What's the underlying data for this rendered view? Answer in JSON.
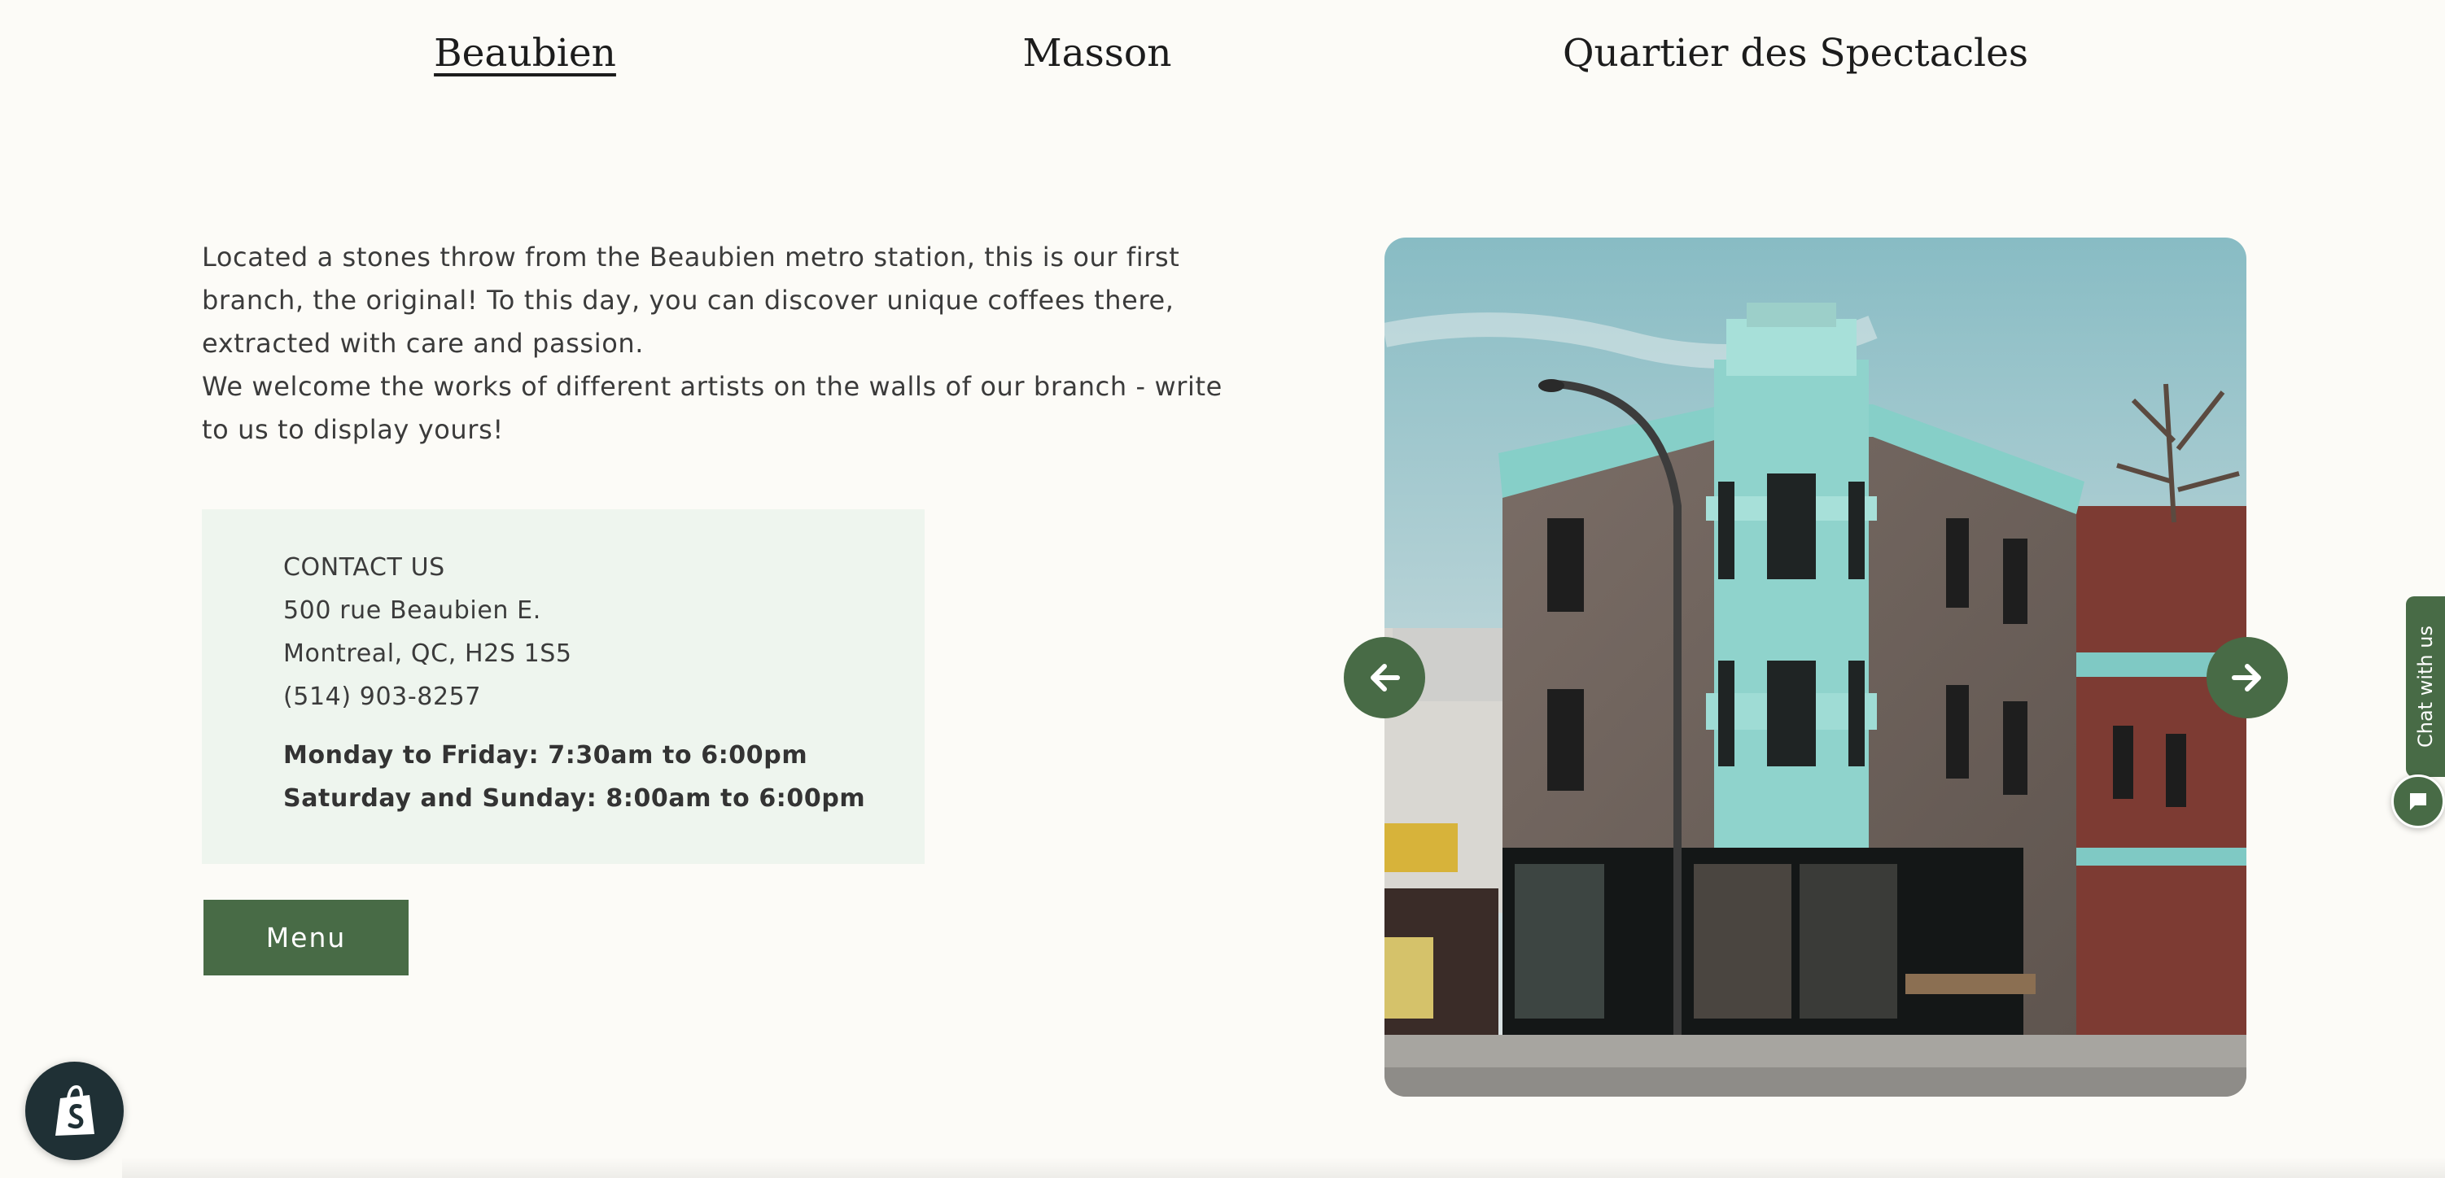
{
  "tabs": [
    {
      "label": "Beaubien",
      "active": true
    },
    {
      "label": "Masson",
      "active": false
    },
    {
      "label": "Quartier des Spectacles",
      "active": false
    }
  ],
  "description": {
    "paragraphs": [
      "Located a stones throw from the Beaubien metro station, this is our first branch, the original! To this day, you can discover unique coffees there, extracted with care and passion.",
      "We welcome the works of different artists on the walls of our branch - write to us to display yours!"
    ]
  },
  "contact": {
    "heading": "CONTACT US",
    "address_line1": "500 rue Beaubien E.",
    "address_line2": "Montreal, QC, H2S 1S5",
    "phone": "(514) 903-8257",
    "hours_weekday": "Monday to Friday: 7:30am to 6:00pm",
    "hours_weekend": "Saturday and Sunday: 8:00am to 6:00pm"
  },
  "menu_button": {
    "label": "Menu"
  },
  "carousel": {
    "image": "storefront-photo",
    "prev_icon": "arrow-left-icon",
    "next_icon": "arrow-right-icon"
  },
  "chat": {
    "label": "Chat with us",
    "icon": "chat-bubble-icon"
  },
  "shopify_badge": {
    "icon": "shopify-bag-icon"
  },
  "colors": {
    "accent": "#486b46",
    "background": "#fcfbf7",
    "contact_bg": "#eef5ee",
    "text": "#3b3b3b"
  }
}
